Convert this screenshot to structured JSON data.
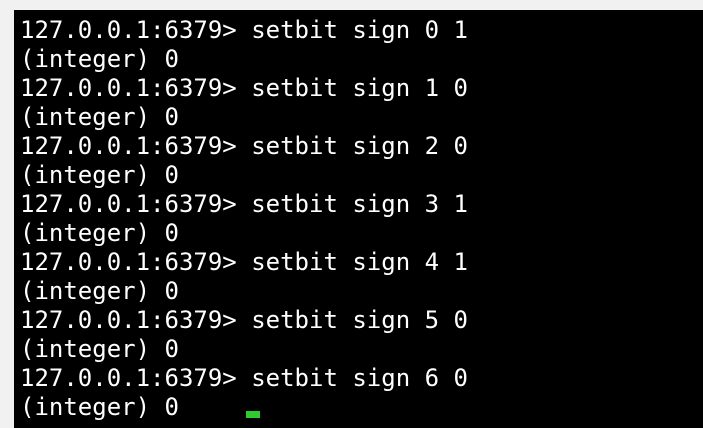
{
  "terminal": {
    "lines": [
      {
        "kind": "command",
        "prompt": "127.0.0.1:6379>",
        "command": "setbit sign 0 1"
      },
      {
        "kind": "output",
        "text": "(integer) 0"
      },
      {
        "kind": "command",
        "prompt": "127.0.0.1:6379>",
        "command": "setbit sign 1 0"
      },
      {
        "kind": "output",
        "text": "(integer) 0"
      },
      {
        "kind": "command",
        "prompt": "127.0.0.1:6379>",
        "command": "setbit sign 2 0"
      },
      {
        "kind": "output",
        "text": "(integer) 0"
      },
      {
        "kind": "command",
        "prompt": "127.0.0.1:6379>",
        "command": "setbit sign 3 1"
      },
      {
        "kind": "output",
        "text": "(integer) 0"
      },
      {
        "kind": "command",
        "prompt": "127.0.0.1:6379>",
        "command": "setbit sign 4 1"
      },
      {
        "kind": "output",
        "text": "(integer) 0"
      },
      {
        "kind": "command",
        "prompt": "127.0.0.1:6379>",
        "command": "setbit sign 5 0"
      },
      {
        "kind": "output",
        "text": "(integer) 0"
      },
      {
        "kind": "command",
        "prompt": "127.0.0.1:6379>",
        "command": "setbit sign 6 0"
      },
      {
        "kind": "output",
        "text": "(integer) 0"
      }
    ]
  },
  "colors": {
    "background": "#000000",
    "text": "#ffffff",
    "cursor": "#2ecc2e",
    "frame": "#f1f1f1"
  }
}
